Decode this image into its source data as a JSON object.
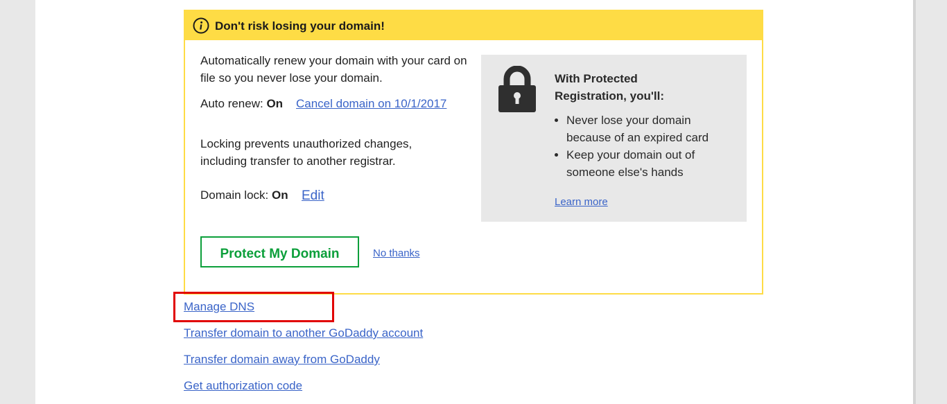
{
  "promo": {
    "title": "Don't risk losing your domain!",
    "auto_renew_description": "Automatically renew your domain with your card on file so you never lose your domain.",
    "auto_renew_label": "Auto renew: ",
    "auto_renew_value": "On",
    "cancel_link": "Cancel domain on 10/1/2017",
    "lock_description": "Locking prevents unauthorized changes, including transfer to another registrar.",
    "domain_lock_label": "Domain lock: ",
    "domain_lock_value": "On",
    "edit_link": "Edit",
    "protect_button": "Protect My Domain",
    "no_thanks_link": "No thanks"
  },
  "benefits": {
    "title": "With Protected Registration, you'll:",
    "items": [
      "Never lose your domain because of an expired card",
      "Keep your domain out of someone else's hands"
    ],
    "learn_more": "Learn more"
  },
  "domain_actions": {
    "manage_dns": "Manage DNS",
    "transfer_to_account": "Transfer domain to another GoDaddy account",
    "transfer_away": "Transfer domain away from GoDaddy",
    "auth_code": "Get authorization code"
  },
  "icons": {
    "info": "info-icon",
    "lock": "padlock-icon"
  },
  "colors": {
    "banner_yellow": "#fedc45",
    "link_blue": "#3a64c8",
    "button_green": "#0b9f3a",
    "highlight_red": "#e10000",
    "panel_gray": "#e8e8e8"
  }
}
